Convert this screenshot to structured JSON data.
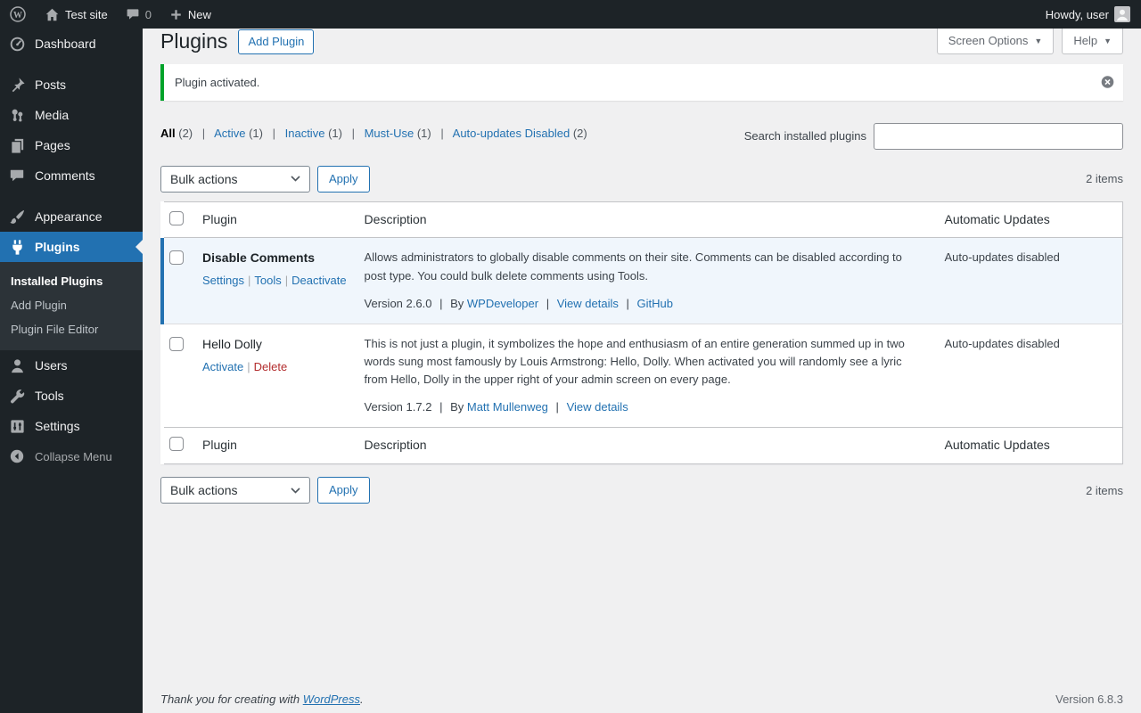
{
  "ui": {
    "sep": "|",
    "chevron_down": "▼"
  },
  "admin_bar": {
    "site_name": "Test site",
    "comment_count": "0",
    "new_label": "New",
    "howdy": "Howdy, user"
  },
  "sidebar": {
    "dashboard": "Dashboard",
    "posts": "Posts",
    "media": "Media",
    "pages": "Pages",
    "comments": "Comments",
    "appearance": "Appearance",
    "plugins": "Plugins",
    "users": "Users",
    "tools": "Tools",
    "settings": "Settings",
    "collapse": "Collapse Menu",
    "plugins_submenu": {
      "installed": "Installed Plugins",
      "add": "Add Plugin",
      "editor": "Plugin File Editor"
    }
  },
  "header": {
    "title": "Plugins",
    "add_plugin_label": "Add Plugin",
    "screen_options_label": "Screen Options",
    "help_label": "Help"
  },
  "notice": {
    "message": "Plugin activated."
  },
  "filters": {
    "items": [
      {
        "label": "All",
        "count": "(2)"
      },
      {
        "label": "Active",
        "count": "(1)"
      },
      {
        "label": "Inactive",
        "count": "(1)"
      },
      {
        "label": "Must-Use",
        "count": "(1)"
      },
      {
        "label": "Auto-updates Disabled",
        "count": "(2)"
      }
    ]
  },
  "search": {
    "label": "Search installed plugins",
    "value": ""
  },
  "tablenav": {
    "bulk_selected": "Bulk actions",
    "apply_label": "Apply",
    "items_count": "2 items"
  },
  "table": {
    "headers": {
      "plugin": "Plugin",
      "description": "Description",
      "auto_updates": "Automatic Updates"
    },
    "rows": [
      {
        "name": "Disable Comments",
        "actions": {
          "0": "Settings",
          "1": "Tools",
          "2": "Deactivate"
        },
        "description": "Allows administrators to globally disable comments on their site. Comments can be disabled according to post type. You could bulk delete comments using Tools.",
        "version": "Version 2.6.0",
        "by_label": "By",
        "author": "WPDeveloper",
        "link1": "View details",
        "link2": "GitHub",
        "auto_updates": "Auto-updates disabled"
      },
      {
        "name": "Hello Dolly",
        "actions": {
          "0": "Activate",
          "1": "Delete"
        },
        "description": "This is not just a plugin, it symbolizes the hope and enthusiasm of an entire generation summed up in two words sung most famously by Louis Armstrong: Hello, Dolly. When activated you will randomly see a lyric from Hello, Dolly in the upper right of your admin screen on every page.",
        "version": "Version 1.7.2",
        "by_label": "By",
        "author": "Matt Mullenweg",
        "link1": "View details",
        "auto_updates": "Auto-updates disabled"
      }
    ]
  },
  "footer": {
    "thanks_prefix": "Thank you for creating with",
    "wordpress_link": "WordPress",
    "thanks_suffix": ".",
    "version": "Version 6.8.3"
  }
}
